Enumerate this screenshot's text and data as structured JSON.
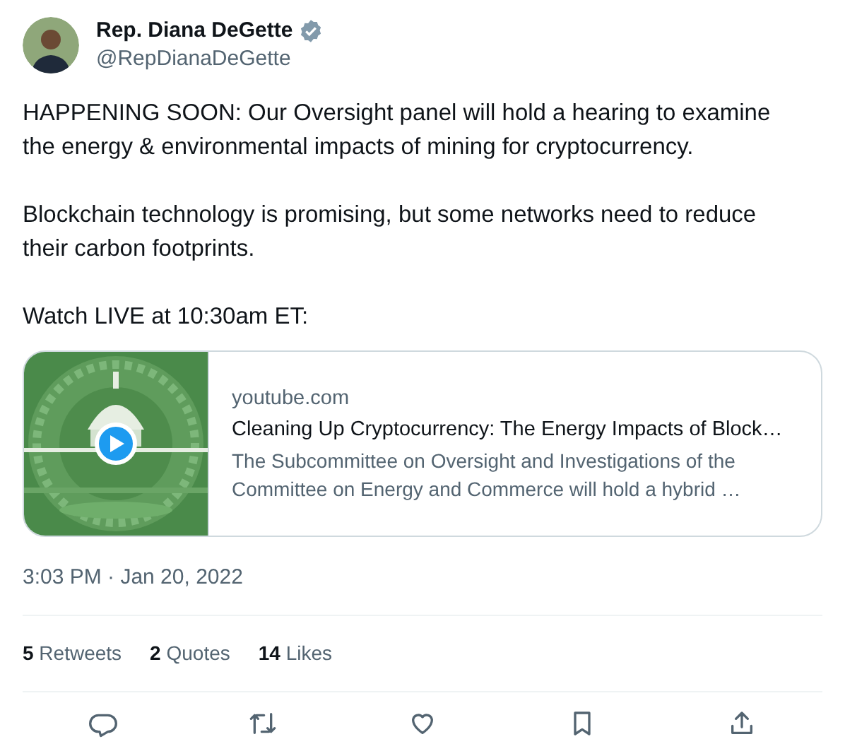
{
  "author": {
    "name": "Rep. Diana DeGette",
    "handle": "@RepDianaDeGette"
  },
  "paragraphs": [
    "HAPPENING SOON: Our Oversight panel will hold a hearing to examine the energy & environmental impacts of mining for cryptocurrency.",
    "Blockchain technology is promising, but some networks need to reduce their carbon footprints.",
    "Watch LIVE at 10:30am ET:"
  ],
  "link_card": {
    "domain": "youtube.com",
    "title": "Cleaning Up Cryptocurrency: The Energy Impacts of Block…",
    "description": "The Subcommittee on Oversight and Investigations of the Committee on Energy and Commerce will hold a hybrid …"
  },
  "timestamp": "3:03 PM · Jan 20, 2022",
  "stats": [
    {
      "count": "5",
      "label": "Retweets"
    },
    {
      "count": "2",
      "label": "Quotes"
    },
    {
      "count": "14",
      "label": "Likes"
    }
  ]
}
